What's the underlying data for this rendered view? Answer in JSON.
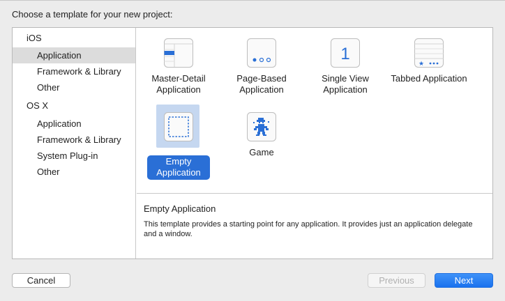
{
  "heading": "Choose a template for your new project:",
  "sidebar": {
    "groups": [
      {
        "label": "iOS",
        "items": [
          "Application",
          "Framework & Library",
          "Other"
        ]
      },
      {
        "label": "OS X",
        "items": [
          "Application",
          "Framework & Library",
          "System Plug-in",
          "Other"
        ]
      }
    ],
    "selected": "iOS / Application"
  },
  "templates": [
    {
      "label": "Master-Detail Application",
      "icon": "master-detail-icon"
    },
    {
      "label": "Page-Based Application",
      "icon": "page-based-icon"
    },
    {
      "label": "Single View Application",
      "icon": "single-view-icon",
      "icon_text": "1"
    },
    {
      "label": "Tabbed Application",
      "icon": "tabbed-icon"
    },
    {
      "label": "Empty Application",
      "icon": "empty-app-icon",
      "selected": true
    },
    {
      "label": "Game",
      "icon": "game-icon"
    }
  ],
  "description": {
    "title": "Empty Application",
    "text": "This template provides a starting point for any application. It provides just an application delegate and a window."
  },
  "buttons": {
    "cancel": "Cancel",
    "previous": "Previous",
    "next": "Next"
  },
  "colors": {
    "accent": "#1a72ee",
    "selection_bg": "#c5d7f0",
    "sidebar_selected": "#dcdcdc"
  }
}
